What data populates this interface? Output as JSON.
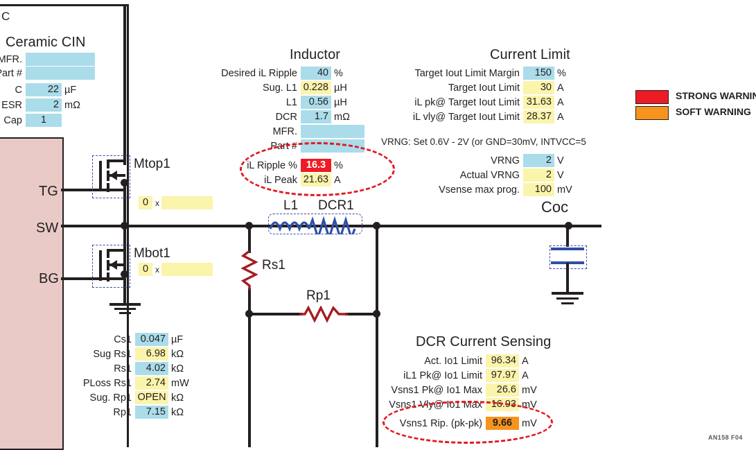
{
  "figure": {
    "credit": "AN158 F04",
    "top_left_letter": "C"
  },
  "legend": {
    "items": [
      {
        "label": "STRONG WARNING",
        "color": "#ed1c24"
      },
      {
        "label": "SOFT WARNING",
        "color": "#f7941e"
      }
    ]
  },
  "ceramic_cin": {
    "title": "Ceramic CIN",
    "rows": [
      {
        "label": "MFR.",
        "value": "",
        "unit": "",
        "style": "blue"
      },
      {
        "label": "Part #",
        "value": "",
        "unit": "",
        "style": "blue"
      },
      {
        "label": "C",
        "value": "22",
        "unit": "µF",
        "style": "blue"
      },
      {
        "label": "ESR",
        "value": "2",
        "unit": "mΩ",
        "style": "blue"
      },
      {
        "label": "Cap",
        "value": "1",
        "unit": "",
        "style": "blue"
      }
    ]
  },
  "inductor": {
    "title": "Inductor",
    "rows": [
      {
        "label": "Desired iL Ripple",
        "value": "40",
        "unit": "%",
        "style": "blue"
      },
      {
        "label": "Sug. L1",
        "value": "0.228",
        "unit": "µH",
        "style": "yellow"
      },
      {
        "label": "L1",
        "value": "0.56",
        "unit": "µH",
        "style": "blue"
      },
      {
        "label": "DCR",
        "value": "1.7",
        "unit": "mΩ",
        "style": "blue"
      },
      {
        "label": "MFR.",
        "value": "",
        "unit": "",
        "style": "blue"
      },
      {
        "label": "Part #",
        "value": "",
        "unit": "",
        "style": "blue"
      },
      {
        "label": "iL Ripple %",
        "value": "16.3",
        "unit": "%",
        "style": "red"
      },
      {
        "label": "iL Peak",
        "value": "21.63",
        "unit": "A",
        "style": "yellow"
      }
    ]
  },
  "current_limit": {
    "title": "Current Limit",
    "rows": [
      {
        "label": "Target Iout Limit Margin",
        "value": "150",
        "unit": "%",
        "style": "blue"
      },
      {
        "label": "Target Iout Limit",
        "value": "30",
        "unit": "A",
        "style": "yellow"
      },
      {
        "label": "iL pk@ Target Iout Limit",
        "value": "31.63",
        "unit": "A",
        "style": "yellow"
      },
      {
        "label": "iL vly@ Target Iout Limit",
        "value": "28.37",
        "unit": "A",
        "style": "yellow"
      }
    ],
    "note": "VRNG:  Set 0.6V - 2V (or GND=30mV, INTVCC=5",
    "rows2": [
      {
        "label": "VRNG",
        "value": "2",
        "unit": "V",
        "style": "blue"
      },
      {
        "label": "Actual VRNG",
        "value": "2",
        "unit": "V",
        "style": "yellow"
      },
      {
        "label": "Vsense max prog.",
        "value": "100",
        "unit": "mV",
        "style": "yellow"
      }
    ]
  },
  "dcr_sensing": {
    "title": "DCR Current Sensing",
    "rows": [
      {
        "label": "Act. Io1 Limit",
        "value": "96.34",
        "unit": "A",
        "style": "yellow"
      },
      {
        "label": "iL1 Pk@ Io1 Limit",
        "value": "97.97",
        "unit": "A",
        "style": "yellow"
      },
      {
        "label": "Vsns1 Pk@ Io1 Max",
        "value": "26.6",
        "unit": "mV",
        "style": "yellow"
      },
      {
        "label": "Vsns1 Vly@ Io1 Max",
        "value": "16.93",
        "unit": "mV",
        "style": "yellow"
      },
      {
        "label": "Vsns1 Rip. (pk-pk)",
        "value": "9.66",
        "unit": "mV",
        "style": "orange"
      }
    ]
  },
  "sense_network": {
    "rows": [
      {
        "label": "Cs1",
        "value": "0.047",
        "unit": "µF",
        "style": "blue"
      },
      {
        "label": "Sug Rs1",
        "value": "6.98",
        "unit": "kΩ",
        "style": "yellow"
      },
      {
        "label": "Rs1",
        "value": "4.02",
        "unit": "kΩ",
        "style": "blue"
      },
      {
        "label": "PLoss Rs1",
        "value": "2.74",
        "unit": "mW",
        "style": "yellow"
      },
      {
        "label": "Sug. Rp1",
        "value": "OPEN",
        "unit": "kΩ",
        "style": "yellow"
      },
      {
        "label": "Rp1",
        "value": "7.15",
        "unit": "kΩ",
        "style": "blue"
      }
    ]
  },
  "schematic": {
    "ic_pins": [
      "TG",
      "SW",
      "BG"
    ],
    "components": [
      {
        "name": "Mtop1"
      },
      {
        "name": "Mbot1"
      },
      {
        "name": "L1"
      },
      {
        "name": "DCR1"
      },
      {
        "name": "Rs1"
      },
      {
        "name": "Rp1"
      },
      {
        "name": "Coc"
      }
    ],
    "fet_multipliers": [
      {
        "count": "0",
        "x": "x",
        "part": ""
      },
      {
        "count": "0",
        "x": "x",
        "part": ""
      }
    ]
  }
}
